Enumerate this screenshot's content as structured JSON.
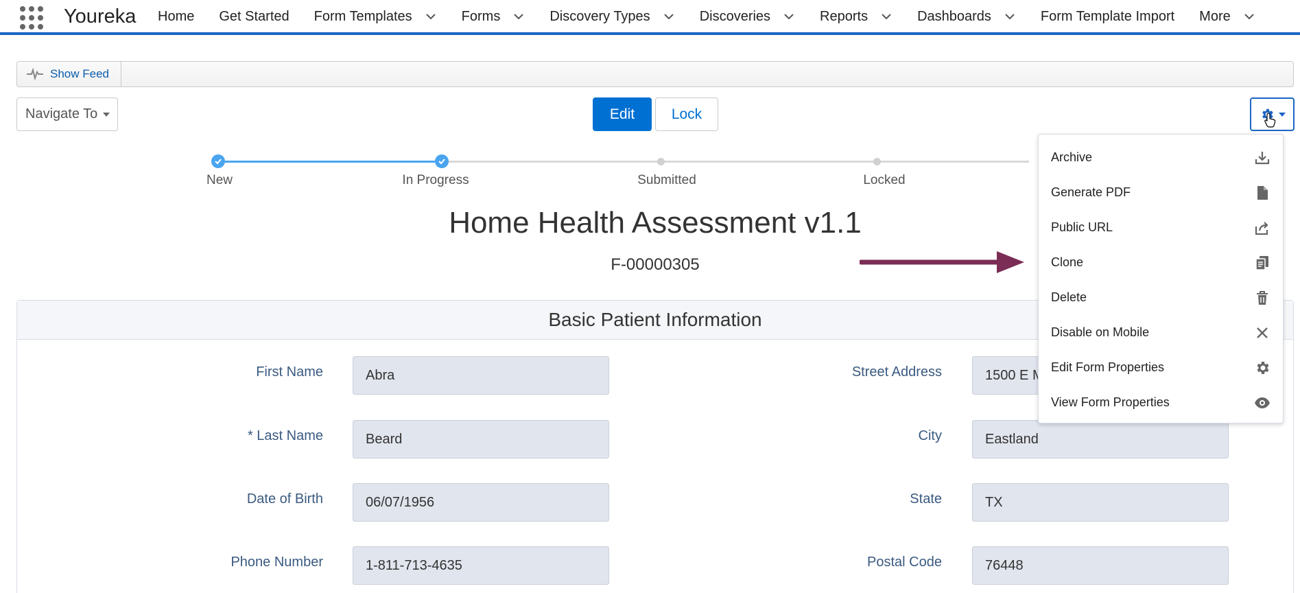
{
  "app": {
    "name": "Youreka"
  },
  "nav": {
    "items": [
      {
        "label": "Home",
        "dropdown": false
      },
      {
        "label": "Get Started",
        "dropdown": false
      },
      {
        "label": "Form Templates",
        "dropdown": true
      },
      {
        "label": "Forms",
        "dropdown": true
      },
      {
        "label": "Discovery Types",
        "dropdown": true
      },
      {
        "label": "Discoveries",
        "dropdown": true
      },
      {
        "label": "Reports",
        "dropdown": true
      },
      {
        "label": "Dashboards",
        "dropdown": true
      },
      {
        "label": "Form Template Import",
        "dropdown": false
      },
      {
        "label": "More",
        "dropdown": true
      }
    ]
  },
  "feed": {
    "button_label": "Show Feed"
  },
  "toolbar": {
    "navigate_label": "Navigate To",
    "edit_label": "Edit",
    "lock_label": "Lock"
  },
  "path": {
    "steps": [
      {
        "label": "New",
        "status": "complete"
      },
      {
        "label": "In Progress",
        "status": "complete"
      },
      {
        "label": "Submitted",
        "status": "incomplete"
      },
      {
        "label": "Locked",
        "status": "incomplete"
      }
    ]
  },
  "record": {
    "title": "Home Health Assessment v1.1",
    "number": "F-00000305"
  },
  "section": {
    "title": "Basic Patient Information",
    "fields_left": [
      {
        "label": "First Name",
        "value": "Abra"
      },
      {
        "label": "* Last Name",
        "value": "Beard"
      },
      {
        "label": "Date of Birth",
        "value": "06/07/1956"
      },
      {
        "label": "Phone Number",
        "value": "1-811-713-4635"
      }
    ],
    "fields_right": [
      {
        "label": "Street Address",
        "value": "1500 E M"
      },
      {
        "label": "City",
        "value": "Eastland"
      },
      {
        "label": "State",
        "value": "TX"
      },
      {
        "label": "Postal Code",
        "value": "76448"
      }
    ]
  },
  "menu": {
    "items": [
      {
        "label": "Archive",
        "icon": "download-icon"
      },
      {
        "label": "Generate PDF",
        "icon": "document-icon"
      },
      {
        "label": "Public URL",
        "icon": "share-icon"
      },
      {
        "label": "Clone",
        "icon": "copy-icon"
      },
      {
        "label": "Delete",
        "icon": "trash-icon"
      },
      {
        "label": "Disable on Mobile",
        "icon": "close-icon"
      },
      {
        "label": "Edit Form Properties",
        "icon": "gear-icon"
      },
      {
        "label": "View Form Properties",
        "icon": "eye-icon"
      }
    ]
  },
  "colors": {
    "brand_blue": "#0070d2",
    "nav_border": "#1b65c4",
    "path_complete": "#4aa5f0",
    "annotation_arrow": "#7b2d55"
  }
}
